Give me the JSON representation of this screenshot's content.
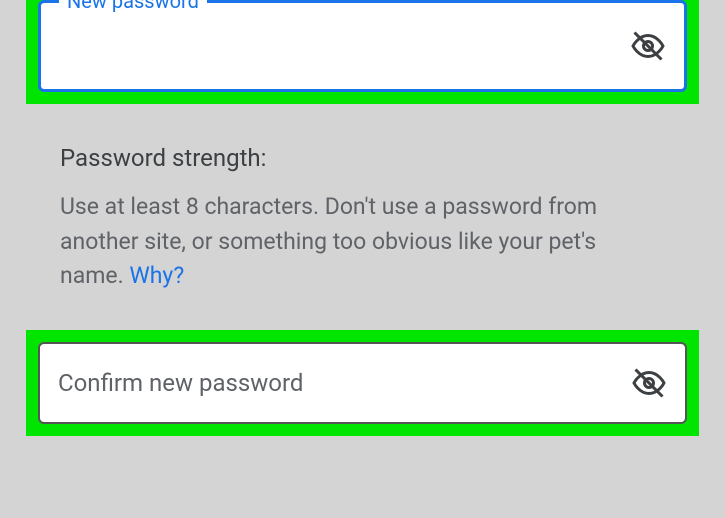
{
  "newPassword": {
    "label": "New password",
    "value": ""
  },
  "strength": {
    "title": "Password strength:",
    "hint": "Use at least 8 characters. Don't use a password from another site, or something too obvious like your pet's name. ",
    "whyLink": "Why?"
  },
  "confirmPassword": {
    "placeholder": "Confirm new password",
    "value": ""
  }
}
